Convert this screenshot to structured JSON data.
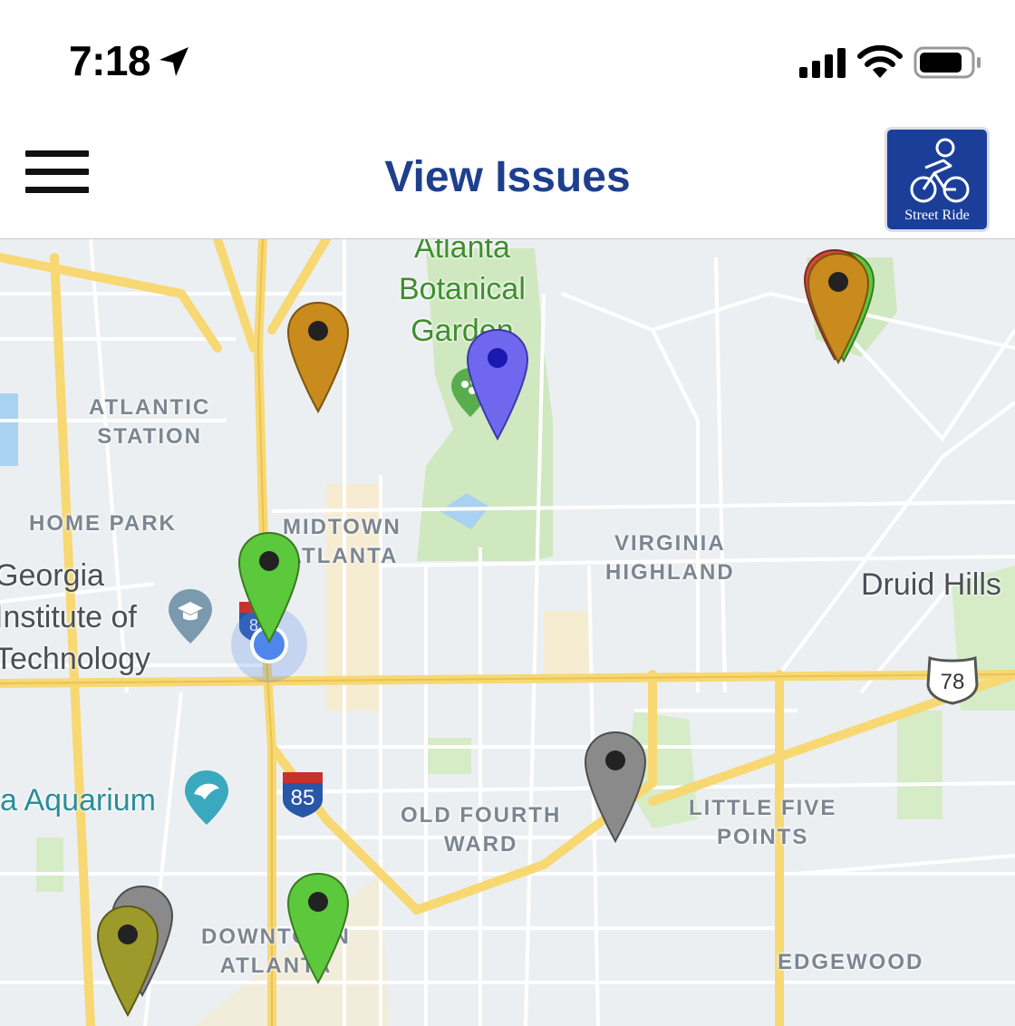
{
  "status_bar": {
    "time": "7:18"
  },
  "nav": {
    "title": "View Issues",
    "logo_text": "Street Ride"
  },
  "map": {
    "districts": {
      "atlantic_station": "ATLANTIC\nSTATION",
      "home_park": "HOME PARK",
      "midtown": "MIDTOWN\nATLANTA",
      "virginia_highland": "VIRGINIA\nHIGHLAND",
      "old_fourth_ward": "OLD FOURTH\nWARD",
      "little_five_points": "LITTLE FIVE\nPOINTS",
      "downtown": "DOWNTOWN\nATLANTA",
      "edgewood": "EDGEWOOD"
    },
    "places": {
      "botanical_garden": "Atlanta\nBotanical\nGarden",
      "georgia_tech": "Georgia\nInstitute of\nTechnology",
      "druid_hills": "Druid Hills",
      "aquarium": "a Aquarium"
    },
    "shields": {
      "i85_top": "85",
      "i85": "85",
      "us78": "78"
    },
    "pin_colors": {
      "orange": "#c98a1e",
      "blue": "#6f68ee",
      "green": "#5cc83c",
      "gray": "#8a8a8a",
      "olive": "#9c9a2a",
      "user_location": "#4f86ec"
    }
  }
}
